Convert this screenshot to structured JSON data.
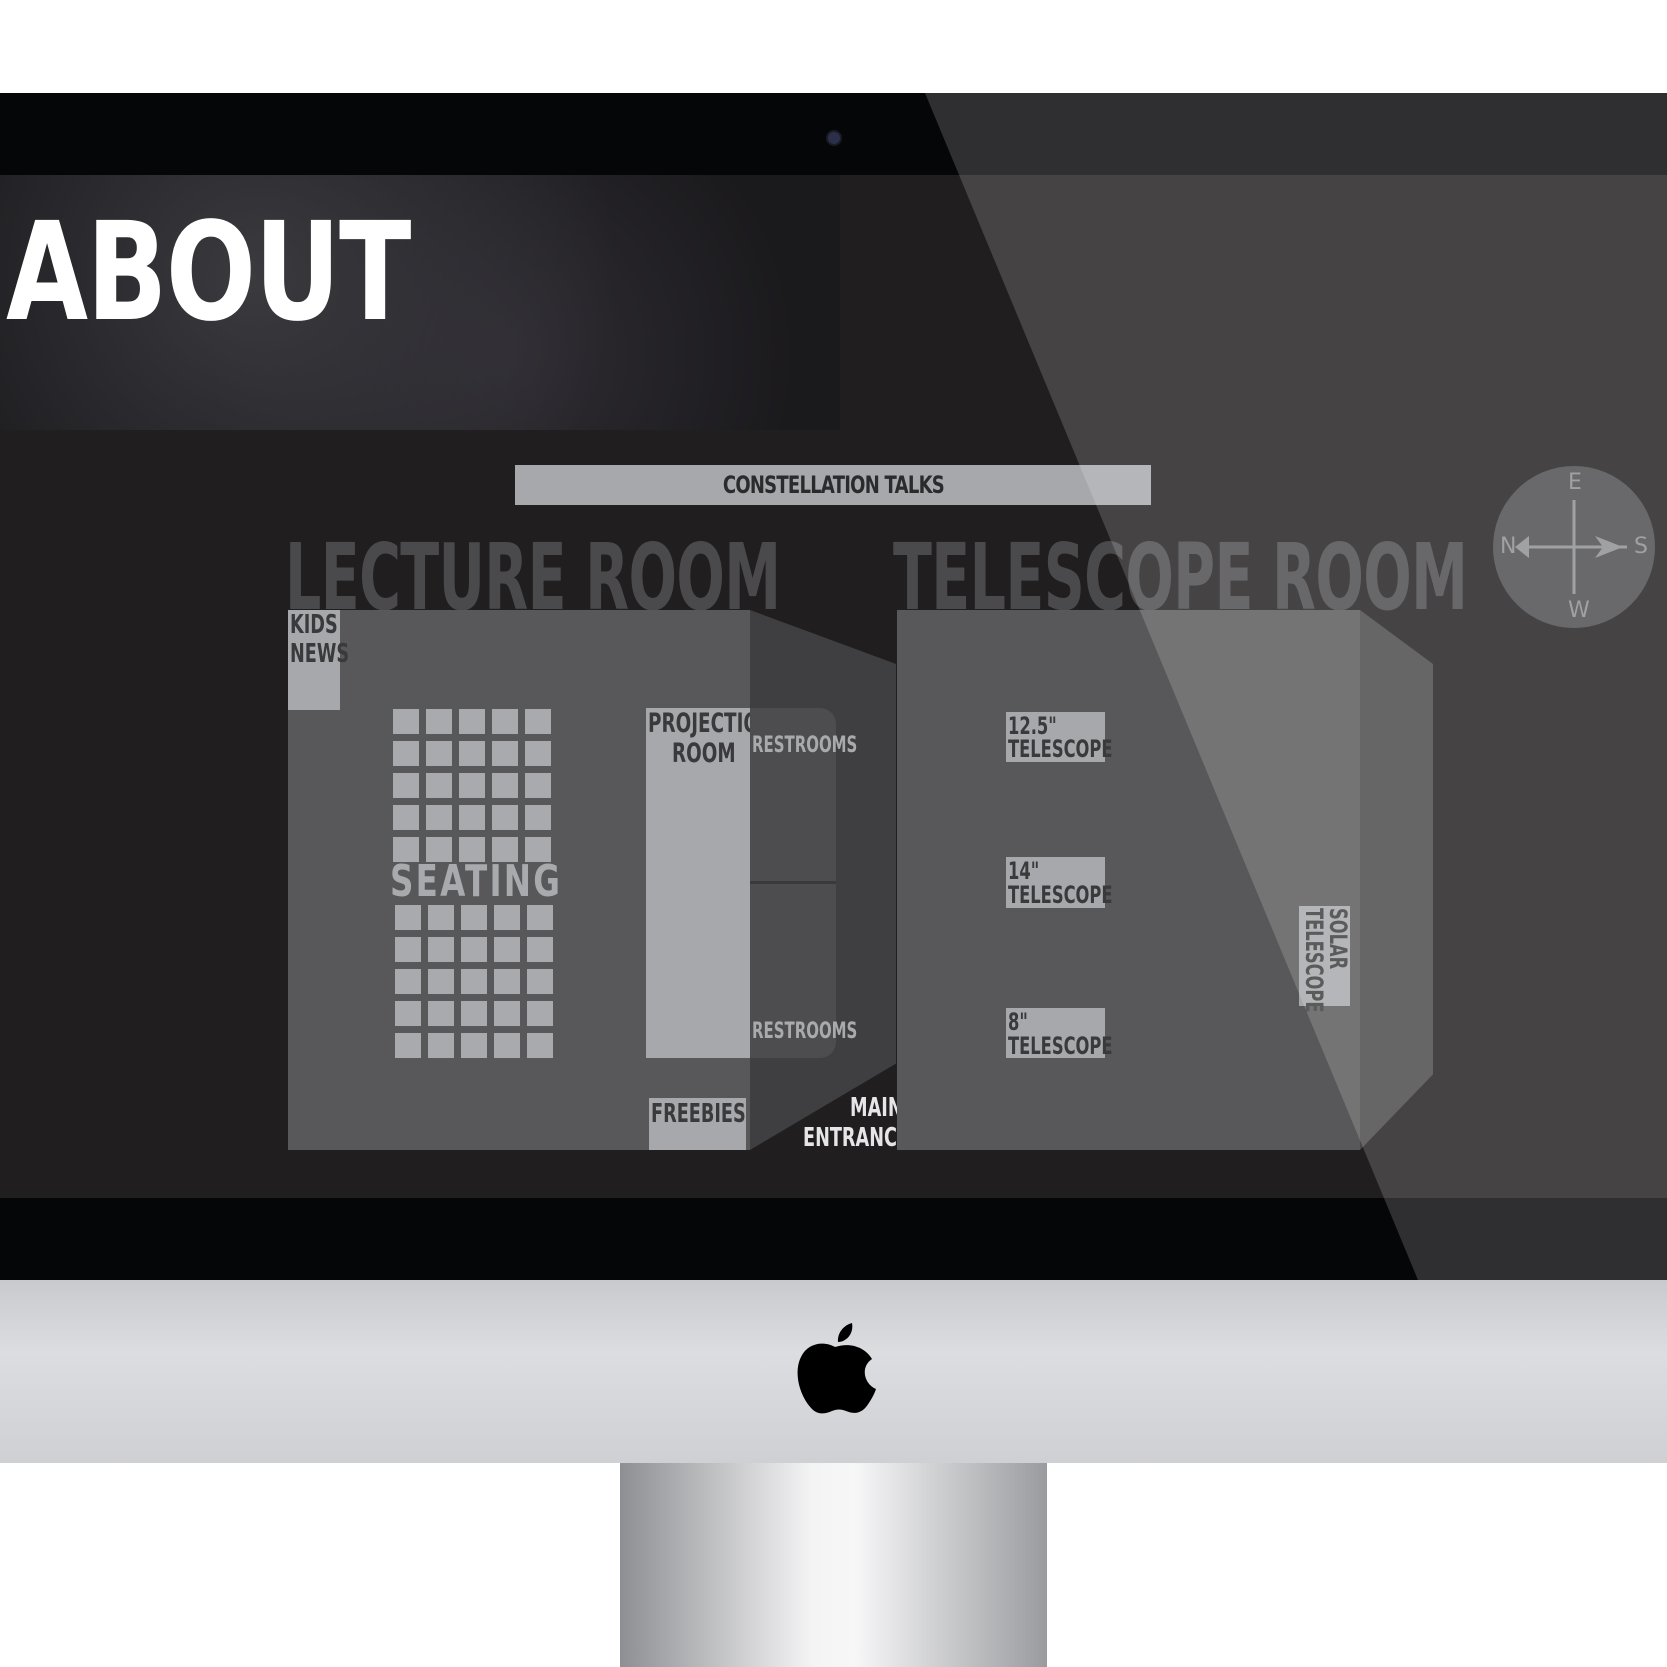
{
  "page": {
    "title": "ABOUT",
    "banner": "CONSTELLATION TALKS"
  },
  "rooms": {
    "lecture": "LECTURE ROOM",
    "telescope": "TELESCOPE ROOM"
  },
  "areas": {
    "kids_news_1": "KIDS",
    "kids_news_2": "NEWS",
    "projection_1": "PROJECTION",
    "projection_2": "ROOM",
    "restrooms_top": "RESTROOMS",
    "restrooms_bottom": "RESTROOMS",
    "seating": "SEATING",
    "freebies": "FREEBIES",
    "entrance_1": "MAIN",
    "entrance_2": "ENTRANCE"
  },
  "telescopes": {
    "t1_size": "12.5\"",
    "t1_label": "TELESCOPE",
    "t2_size": "14\"",
    "t2_label": "TELESCOPE",
    "t3_size": "8\"",
    "t3_label": "TELESCOPE",
    "solar_1": "SOLAR",
    "solar_2": "TELESCOPE"
  },
  "compass": {
    "north": "N",
    "south": "S",
    "east": "E",
    "west": "W"
  },
  "icons": {
    "logo": "apple-logo-icon",
    "camera": "camera-icon",
    "compass": "compass-icon"
  }
}
